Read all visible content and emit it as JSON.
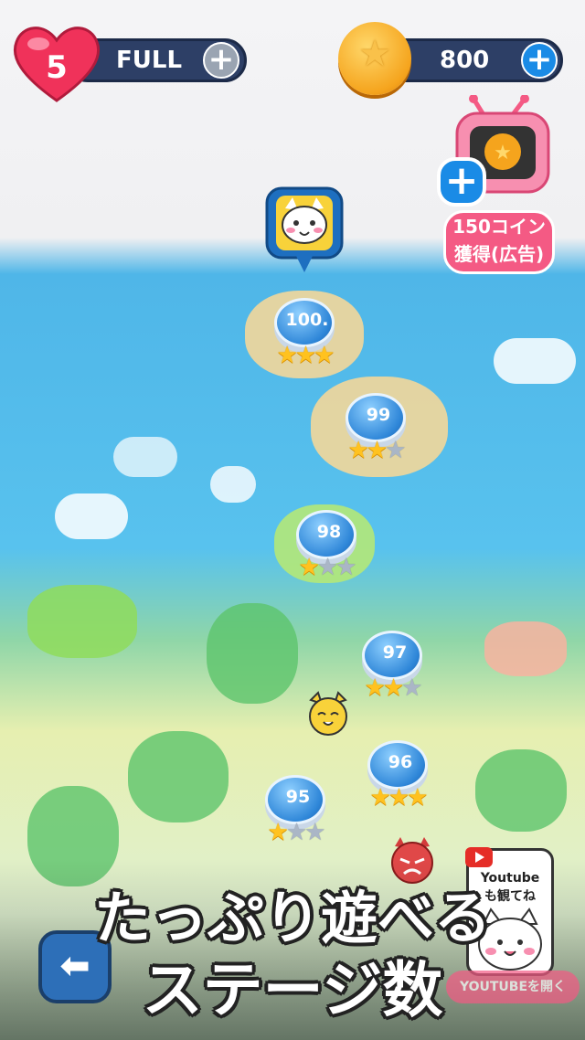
{
  "hud": {
    "lives_count": "5",
    "lives_status": "FULL",
    "coins": "800"
  },
  "ad_reward": {
    "label_line1": "150コイン",
    "label_line2": "獲得(広告)"
  },
  "levels": [
    {
      "number": "100.",
      "stars": [
        1,
        1,
        1
      ]
    },
    {
      "number": "99",
      "stars": [
        1,
        1,
        0
      ]
    },
    {
      "number": "98",
      "stars": [
        1,
        0,
        0
      ]
    },
    {
      "number": "97",
      "stars": [
        1,
        1,
        0
      ]
    },
    {
      "number": "96",
      "stars": [
        1,
        1,
        1
      ]
    },
    {
      "number": "95",
      "stars": [
        1,
        0,
        0
      ]
    }
  ],
  "youtube": {
    "card_line1": "Youtube",
    "card_line2": "も観てね",
    "button_label": "YOUTUBEを開く"
  },
  "promo": {
    "line1": "たっぷり遊べる",
    "line2": "ステージ数"
  },
  "colors": {
    "pill_bg": "#2d3f66",
    "heart": "#f0325a",
    "plus_blue": "#1a8be6",
    "plus_grey": "#9aa4b2",
    "node_blue": "#2e86d8",
    "star": "#ffc21f"
  }
}
